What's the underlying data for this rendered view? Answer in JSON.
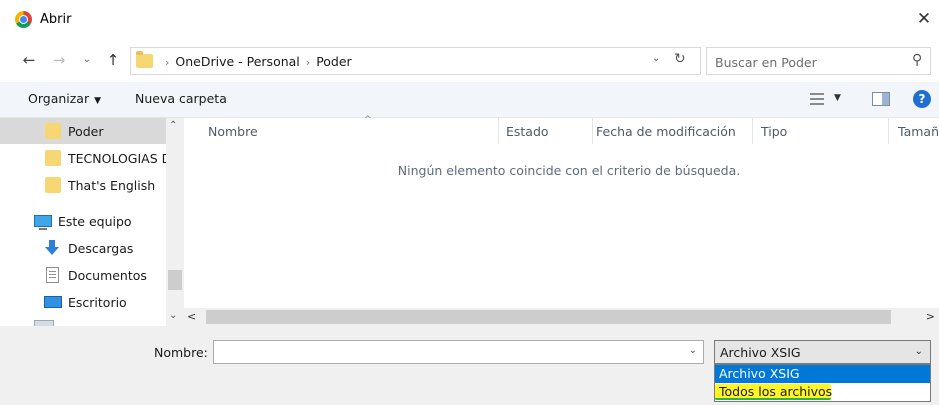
{
  "window": {
    "title": "Abrir",
    "close_glyph": "✕"
  },
  "navigation": {
    "back_glyph": "←",
    "forward_glyph": "→",
    "recent_glyph": "⌄",
    "up_glyph": "↑",
    "breadcrumb": [
      "OneDrive - Personal",
      "Poder"
    ],
    "separator_glyph": "›",
    "dropdown_glyph": "⌄",
    "refresh_glyph": "↻"
  },
  "search": {
    "placeholder": "Buscar en Poder",
    "icon_glyph": "⚲"
  },
  "toolbar": {
    "organize_label": "Organizar",
    "organize_caret": "▼",
    "new_folder_label": "Nueva carpeta",
    "view_caret": "▼",
    "help_label": "?"
  },
  "sidebar": {
    "items": [
      {
        "label": "Poder",
        "icon": "folder-icon",
        "selected": true
      },
      {
        "label": "TECNOLOGIAS D",
        "icon": "folder-icon"
      },
      {
        "label": "That's English",
        "icon": "folder-icon"
      },
      {
        "label": "Este equipo",
        "icon": "computer-icon"
      },
      {
        "label": "Descargas",
        "icon": "download-icon"
      },
      {
        "label": "Documentos",
        "icon": "documents-icon"
      },
      {
        "label": "Escritorio",
        "icon": "desktop-icon"
      }
    ],
    "scroll_up_glyph": "⌃",
    "scroll_down_glyph": "⌄"
  },
  "file_list": {
    "columns": [
      "Nombre",
      "Estado",
      "Fecha de modificación",
      "Tipo",
      "Tamaño"
    ],
    "sort_glyph": "^",
    "empty_message": "Ningún elemento coincide con el criterio de búsqueda.",
    "scroll_left_glyph": "<",
    "scroll_right_glyph": ">"
  },
  "bottom": {
    "filename_label": "Nombre:",
    "filename_value": "",
    "filename_dropdown_glyph": "⌄",
    "filetype_selected": "Archivo XSIG",
    "filetype_caret": "⌄",
    "filetype_options": [
      "Archivo XSIG",
      "Todos los archivos"
    ]
  },
  "colors": {
    "accent": "#0078d7",
    "toolbar_bg": "#f2f6fb",
    "highlight": "#fff200"
  }
}
